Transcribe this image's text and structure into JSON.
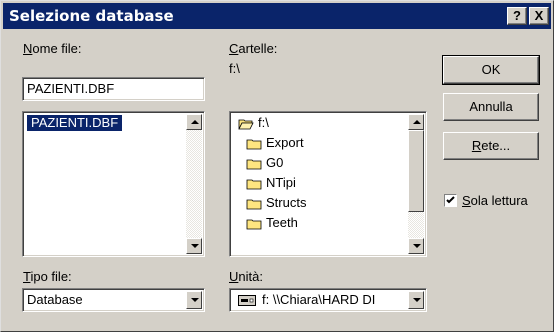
{
  "window": {
    "title": "Selezione database",
    "help_label": "?",
    "close_label": "X"
  },
  "filename": {
    "label_u": "N",
    "label_rest": "ome file:",
    "value": "PAZIENTI.DBF",
    "files": [
      "PAZIENTI.DBF"
    ]
  },
  "folders": {
    "label_u": "C",
    "label_rest": "artelle:",
    "current_path": "f:\\",
    "tree": [
      {
        "name": "f:\\",
        "icon": "open-folder-icon"
      },
      {
        "name": "Export",
        "icon": "folder-icon"
      },
      {
        "name": "G0",
        "icon": "folder-icon"
      },
      {
        "name": "NTipi",
        "icon": "folder-icon"
      },
      {
        "name": "Structs",
        "icon": "folder-icon"
      },
      {
        "name": "Teeth",
        "icon": "folder-icon"
      }
    ]
  },
  "filetype": {
    "label_u": "T",
    "label_rest": "ipo file:",
    "value": "Database"
  },
  "drive": {
    "label_u": "U",
    "label_rest": "nità:",
    "value": "f: \\\\Chiara\\HARD DI"
  },
  "buttons": {
    "ok": "OK",
    "cancel": "Annulla",
    "network_u": "R",
    "network_rest": "ete..."
  },
  "readonly": {
    "label_u": "S",
    "label_rest": "ola lettura",
    "checked": true
  },
  "colors": {
    "title_bg": "#0a246a",
    "selection": "#0a246a",
    "face": "#d4d0c8"
  }
}
